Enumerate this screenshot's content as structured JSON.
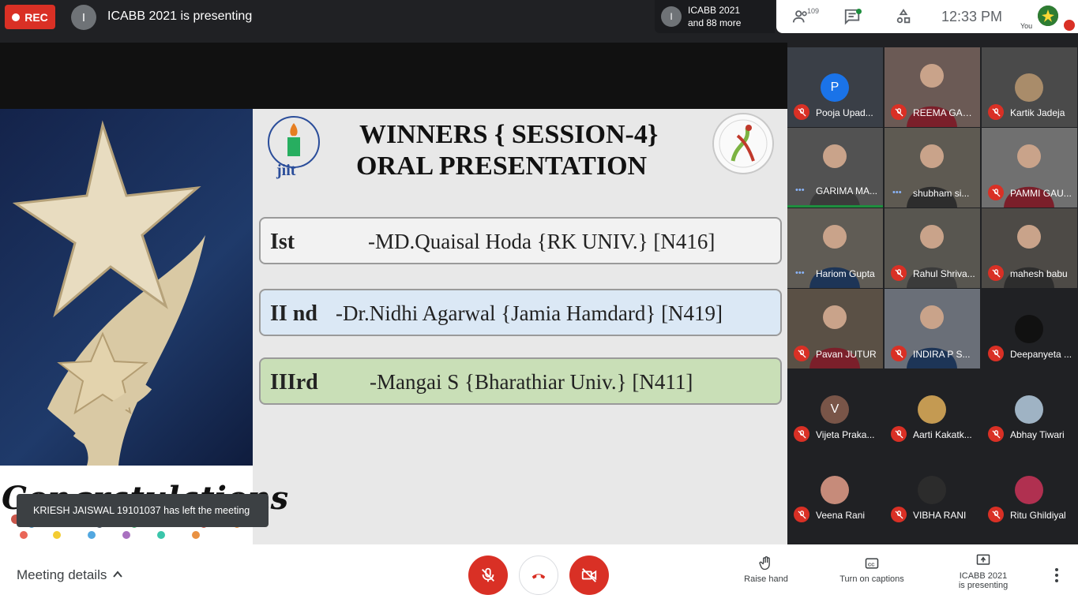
{
  "topbar": {
    "rec_label": "REC",
    "presenter_initial": "I",
    "presenting_title": "ICABB 2021 is presenting",
    "others_initial": "I",
    "others_line1": "ICABB 2021",
    "others_line2": "and 88 more",
    "participant_count": "109",
    "clock": "12:33  PM",
    "you_label": "You"
  },
  "slide": {
    "title_line1": "WINNERS { SESSION-4}",
    "title_line2": "ORAL PRESENTATION",
    "congrats_text": "Congratulations",
    "winners": [
      {
        "rank": "Ist",
        "name": "-MD.Quaisal Hoda {RK UNIV.} [N416]"
      },
      {
        "rank": "II nd",
        "name": "-Dr.Nidhi Agarwal {Jamia Hamdard} [N419]"
      },
      {
        "rank": "IIIrd",
        "name": "-Mangai S {Bharathiar Univ.} [N411]"
      }
    ]
  },
  "toast": "KRIESH JAISWAL 19101037 has left the meeting",
  "participants": [
    {
      "name": "Pooja Upad...",
      "initial": "P",
      "color": "#1a73e8"
    },
    {
      "name": "REEMA GAB..."
    },
    {
      "name": "Kartik Jadeja"
    },
    {
      "name": "GARIMA MA..."
    },
    {
      "name": "shubham si..."
    },
    {
      "name": "PAMMI GAU..."
    },
    {
      "name": "Hariom Gupta"
    },
    {
      "name": "Rahul Shriva..."
    },
    {
      "name": "mahesh babu"
    },
    {
      "name": "Pavan JUTUR"
    },
    {
      "name": "INDIRA P S..."
    },
    {
      "name": "Deepanyeta ..."
    },
    {
      "name": "Vijeta Praka...",
      "initial": "V",
      "color": "#795548"
    },
    {
      "name": "Aarti Kakatk..."
    },
    {
      "name": "Abhay Tiwari"
    },
    {
      "name": "Veena Rani"
    },
    {
      "name": "VIBHA RANI"
    },
    {
      "name": "Ritu Ghildiyal"
    }
  ],
  "bottombar": {
    "meeting_details": "Meeting details",
    "raise_hand": "Raise hand",
    "captions": "Turn on captions",
    "presenting_line1": "ICABB 2021",
    "presenting_line2": "is presenting"
  },
  "colors": {
    "danger": "#d93025",
    "speaking_green": "#1e8e3e",
    "row_blue": "#dbe8f5",
    "row_green": "#c9dfb7"
  }
}
